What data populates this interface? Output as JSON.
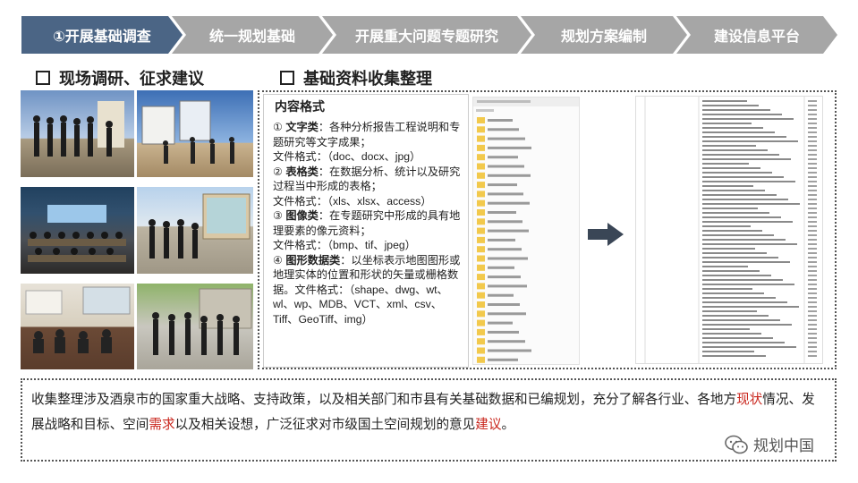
{
  "steps": [
    {
      "label": "①开展基础调查",
      "active": true
    },
    {
      "label": "统一规划基础",
      "active": false
    },
    {
      "label": "开展重大问题专题研究",
      "active": false
    },
    {
      "label": "规划方案编制",
      "active": false
    },
    {
      "label": "建设信息平台",
      "active": false
    }
  ],
  "colors": {
    "active_step": "#4b6585",
    "inactive_step": "#a6a6a6",
    "accent_red": "#c9251c"
  },
  "left_section": {
    "title": "现场调研、征求建议"
  },
  "right_section": {
    "title": "基础资料收集整理"
  },
  "content": {
    "title": "内容格式",
    "items": [
      {
        "num": "① ",
        "name": "文字类",
        "desc": "：各种分析报告工程说明和专题研究等文字成果；",
        "format": "文件格式：（doc、docx、jpg）"
      },
      {
        "num": "② ",
        "name": "表格类",
        "desc": "：在数据分析、统计以及研究过程当中形成的表格；",
        "format": "文件格式：（xls、xlsx、access）"
      },
      {
        "num": "③ ",
        "name": "图像类",
        "desc": "：在专题研究中形成的具有地理要素的像元资料；",
        "format": "文件格式：（bmp、tif、jpeg）"
      },
      {
        "num": "④ ",
        "name": "图形数据类",
        "desc": "：以坐标表示地图图形或地理实体的位置和形状的矢量或栅格数据。文件格式：（shape、dwg、wt、wl、wp、MDB、VCT、xml、csv、Tiff、GeoTiff、img）",
        "format": ""
      }
    ]
  },
  "summary": {
    "part1": "收集整理涉及酒泉市的国家重大战略、支持政策，以及相关部门和市县有关基础数据和已编规划，充分了解各行业、各地方",
    "hl1": "现状",
    "part2": "情况、发展战略和目标、空间",
    "hl2": "需求",
    "part3": "以及相关设想，广泛征求对市级国土空间规划的意见",
    "hl3": "建议",
    "part4": "。"
  },
  "watermark": {
    "text": "规划中国",
    "icon": "wechat-icon"
  }
}
